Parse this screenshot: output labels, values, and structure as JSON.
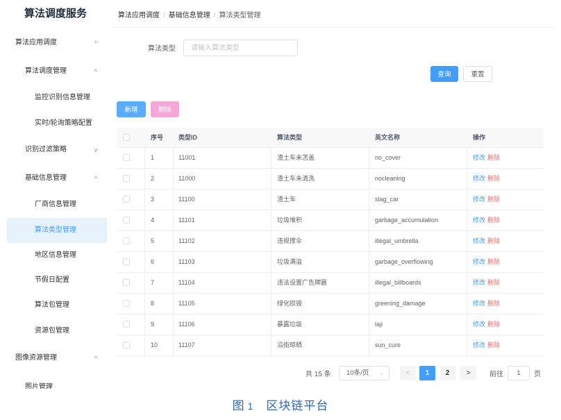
{
  "app": {
    "title": "算法调度服务"
  },
  "breadcrumb": {
    "items": [
      "算法应用调度",
      "基础信息管理",
      "算法类型管理"
    ],
    "separator": "/"
  },
  "sidebar": {
    "items": [
      {
        "label": "算法应用调度",
        "arrow": "^",
        "level": 1
      },
      {
        "label": "算法调度管理",
        "arrow": "^",
        "level": 2
      },
      {
        "label": "监控识别信息管理",
        "level": 3
      },
      {
        "label": "实时/轮询策略配置",
        "level": 3
      },
      {
        "label": "识别过滤策略",
        "arrow": "v",
        "level": 2
      },
      {
        "label": "基础信息管理",
        "arrow": "^",
        "level": 2
      },
      {
        "label": "厂商信息管理",
        "level": 3
      },
      {
        "label": "算法类型管理",
        "level": 3,
        "active": true
      },
      {
        "label": "地区信息管理",
        "level": 3
      },
      {
        "label": "节假日配置",
        "level": 3
      },
      {
        "label": "算法包管理",
        "level": 3
      },
      {
        "label": "资源包管理",
        "level": 3
      },
      {
        "label": "图像资源管理",
        "arrow": "^",
        "level": 1
      },
      {
        "label": "图片管理",
        "level": 2
      }
    ]
  },
  "search": {
    "label": "算法类型",
    "placeholder": "请输入算法类型",
    "value": ""
  },
  "buttons": {
    "query": "查询",
    "reset": "重置",
    "add": "新增",
    "delete": "删除"
  },
  "table": {
    "headers": {
      "index": "序号",
      "type_id": "类型ID",
      "type_name": "算法类型",
      "english_name": "英文名称",
      "ops": "操作"
    },
    "rows": [
      {
        "index": "1",
        "type_id": "11001",
        "type_name": "渣土车未苫盖",
        "english_name": "no_cover",
        "edit": "修改",
        "delete": "删除"
      },
      {
        "index": "2",
        "type_id": "11000",
        "type_name": "渣土车未清洗",
        "english_name": "nocleaning",
        "edit": "修改",
        "delete": "删除"
      },
      {
        "index": "3",
        "type_id": "11100",
        "type_name": "渣土车",
        "english_name": "slag_car",
        "edit": "修改",
        "delete": "删除"
      },
      {
        "index": "4",
        "type_id": "11101",
        "type_name": "垃圾堆积",
        "english_name": "garbage_accumulation",
        "edit": "修改",
        "delete": "删除"
      },
      {
        "index": "5",
        "type_id": "11102",
        "type_name": "违规撑伞",
        "english_name": "illegal_umbrella",
        "edit": "修改",
        "delete": "删除"
      },
      {
        "index": "6",
        "type_id": "11103",
        "type_name": "垃圾满溢",
        "english_name": "garbage_overflowing",
        "edit": "修改",
        "delete": "删除"
      },
      {
        "index": "7",
        "type_id": "11104",
        "type_name": "违法设置广告牌匾",
        "english_name": "illegal_billboards",
        "edit": "修改",
        "delete": "删除"
      },
      {
        "index": "8",
        "type_id": "11105",
        "type_name": "绿化损毁",
        "english_name": "greening_damage",
        "edit": "修改",
        "delete": "删除"
      },
      {
        "index": "9",
        "type_id": "11106",
        "type_name": "暴露垃圾",
        "english_name": "laji",
        "edit": "修改",
        "delete": "删除"
      },
      {
        "index": "10",
        "type_id": "11107",
        "type_name": "沿街晾晒",
        "english_name": "sun_cure",
        "edit": "修改",
        "delete": "删除"
      }
    ]
  },
  "pagination": {
    "total_text": "共 15 条",
    "page_size": "10条/页",
    "prev": "<",
    "pages": [
      "1",
      "2"
    ],
    "current_page": "1",
    "next": ">",
    "goto_label": "前往",
    "goto_value": "1",
    "page_suffix": "页"
  },
  "caption": {
    "prefix": "图",
    "number": "1",
    "text": "区块链平台"
  },
  "colors": {
    "primary": "#409eff",
    "danger": "#f56c6c",
    "add_button": "#59acff",
    "delete_button": "#f8a6d8",
    "active_menu_bg": "#e8f2fd",
    "caption": "#2f67b8"
  }
}
